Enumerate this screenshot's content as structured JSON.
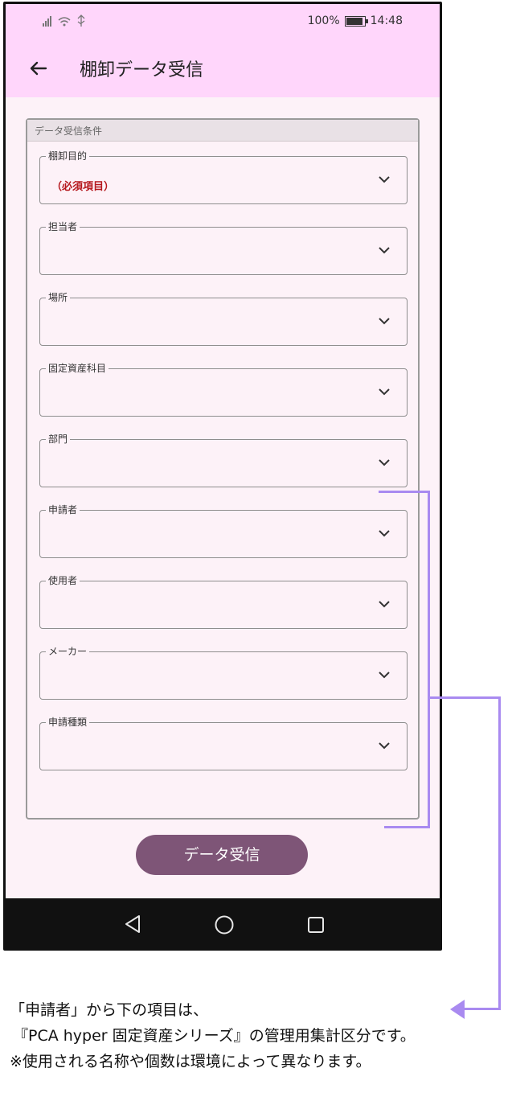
{
  "status_bar": {
    "signal": "ᵡıl",
    "battery_percent": "100%",
    "time": "14:48"
  },
  "app_bar": {
    "back_icon": "arrow-left-icon",
    "title": "棚卸データ受信"
  },
  "panel": {
    "title": "データ受信条件",
    "fields": [
      {
        "label": "棚卸目的",
        "value": "（必須項目）"
      },
      {
        "label": "担当者",
        "value": ""
      },
      {
        "label": "場所",
        "value": ""
      },
      {
        "label": "固定資産科目",
        "value": ""
      },
      {
        "label": "部門",
        "value": ""
      },
      {
        "label": "申請者",
        "value": ""
      },
      {
        "label": "使用者",
        "value": ""
      },
      {
        "label": "メーカー",
        "value": ""
      },
      {
        "label": "申請種類",
        "value": ""
      }
    ]
  },
  "receive_button": {
    "label": "データ受信"
  },
  "nav": {
    "back": "triangle-back-icon",
    "home": "circle-home-icon",
    "recent": "square-recent-icon"
  },
  "annotation": {
    "color": "#a98af0",
    "line1": "「申請者」から下の項目は、",
    "line2": "『PCA hyper 固定資産シリーズ』の管理用集計区分です。",
    "line3": "※使用される名称や個数は環境によって異なります。"
  },
  "colors": {
    "appbar": "#ffd6fb",
    "button": "#7e5577",
    "required": "#b5171c"
  }
}
